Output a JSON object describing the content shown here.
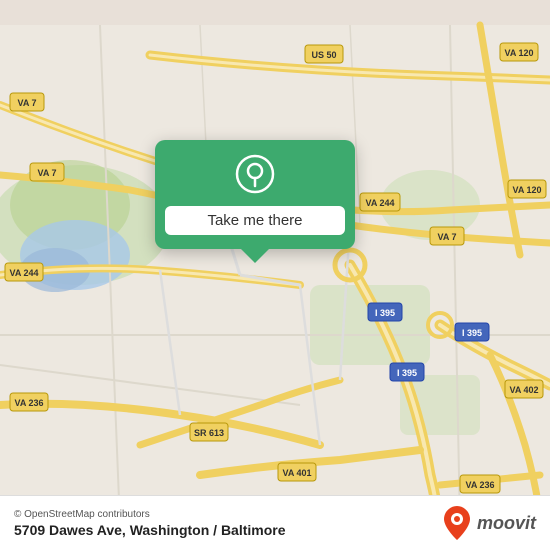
{
  "map": {
    "background_color": "#ede8e0",
    "popup": {
      "button_label": "Take me there",
      "bg_color": "#3daa6e"
    }
  },
  "bottom_bar": {
    "osm_credit": "© OpenStreetMap contributors",
    "address": "5709 Dawes Ave, Washington / Baltimore",
    "moovit_label": "moovit"
  },
  "roads": {
    "highway_color": "#f7d96b",
    "minor_road_color": "#ffffff",
    "road_border": "#ccbba0"
  }
}
